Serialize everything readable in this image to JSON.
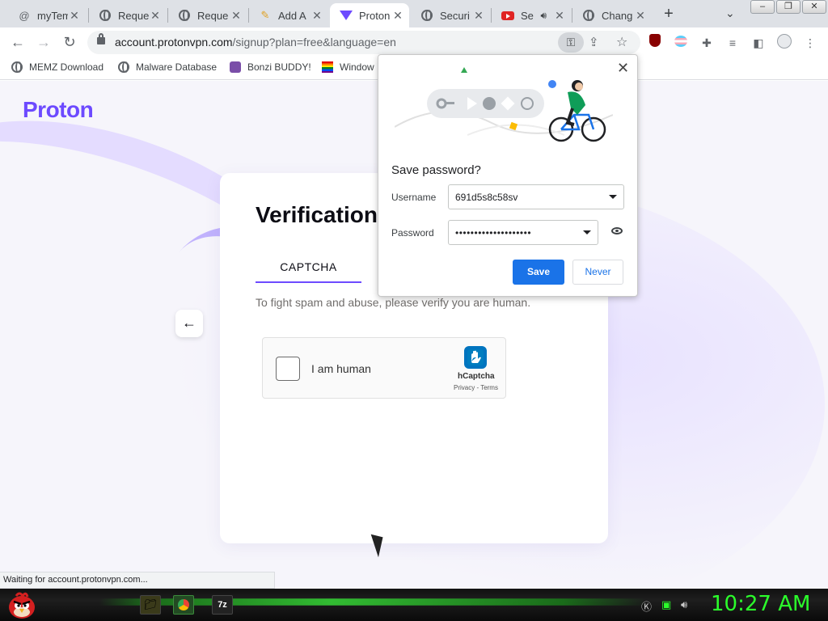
{
  "tabs": [
    {
      "label": "myTem",
      "icon": "at-icon",
      "active": false
    },
    {
      "label": "Reque",
      "icon": "globe-icon",
      "active": false
    },
    {
      "label": "Reque",
      "icon": "globe-icon",
      "active": false
    },
    {
      "label": "Add A",
      "icon": "pencil-icon",
      "active": false
    },
    {
      "label": "Proton",
      "icon": "proton-vpn-icon",
      "active": true
    },
    {
      "label": "Securi",
      "icon": "globe-icon",
      "active": false
    },
    {
      "label": "Se",
      "icon": "youtube-icon",
      "active": false
    },
    {
      "label": "Chang",
      "icon": "globe-icon",
      "active": false
    }
  ],
  "address_bar": {
    "host": "account.protonvpn.com",
    "path": "/signup?plan=free&language=en"
  },
  "bookmarks": [
    {
      "label": "MEMZ Download"
    },
    {
      "label": "Malware Database"
    },
    {
      "label": "Bonzi BUDDY!"
    },
    {
      "label": "Window"
    }
  ],
  "page": {
    "logo": "Proton",
    "title": "Verification",
    "tab": "CAPTCHA",
    "description": "To fight spam and abuse, please verify you are human.",
    "captcha": {
      "label": "I am human",
      "brand": "hCaptcha",
      "links": "Privacy - Terms"
    }
  },
  "save_password": {
    "title": "Save password?",
    "username_label": "Username",
    "username_value": "691d5s8c58sv",
    "password_label": "Password",
    "password_value": "••••••••••••••••••••",
    "save_label": "Save",
    "never_label": "Never"
  },
  "status": "Waiting for account.protonvpn.com...",
  "taskbar": {
    "clock": "10:27 AM"
  },
  "colors": {
    "proton": "#6d4aff",
    "chrome_blue": "#1a73e8",
    "clock_green": "#2bff2b"
  }
}
